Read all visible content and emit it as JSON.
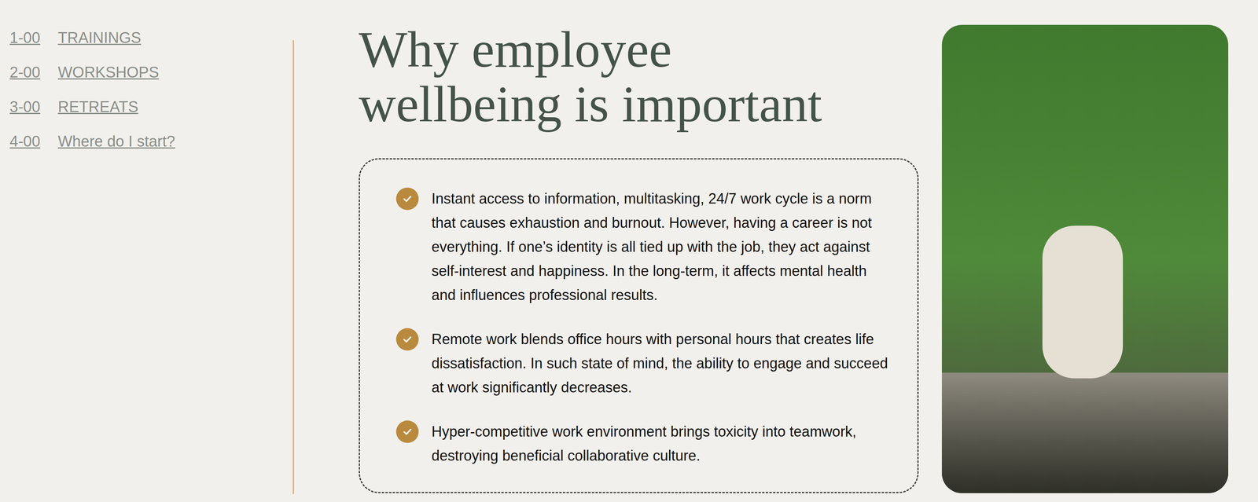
{
  "nav": [
    {
      "number": "1-00",
      "label": "TRAININGS"
    },
    {
      "number": "2-00",
      "label": "WORKSHOPS"
    },
    {
      "number": "3-00",
      "label": "RETREATS"
    },
    {
      "number": "4-00",
      "label": "Where do I start?"
    }
  ],
  "heading": {
    "lines": [
      "Why employee",
      "wellbeing is important"
    ]
  },
  "points": [
    "Instant access to information, multitasking, 24/7 work cycle is a norm that causes exhaustion and burnout. However, having a career is not everything. If one’s identity is all tied up with the job, they act against self-interest and happiness. In the long-term, it affects mental health and influences professional results.",
    "Remote work blends office hours with personal hours that creates life dissatisfaction. In such state of mind, the ability to engage and succeed at work significantly decreases.",
    "Hyper-competitive work environment brings toxicity into teamwork, destroying beneficial collaborative culture."
  ]
}
